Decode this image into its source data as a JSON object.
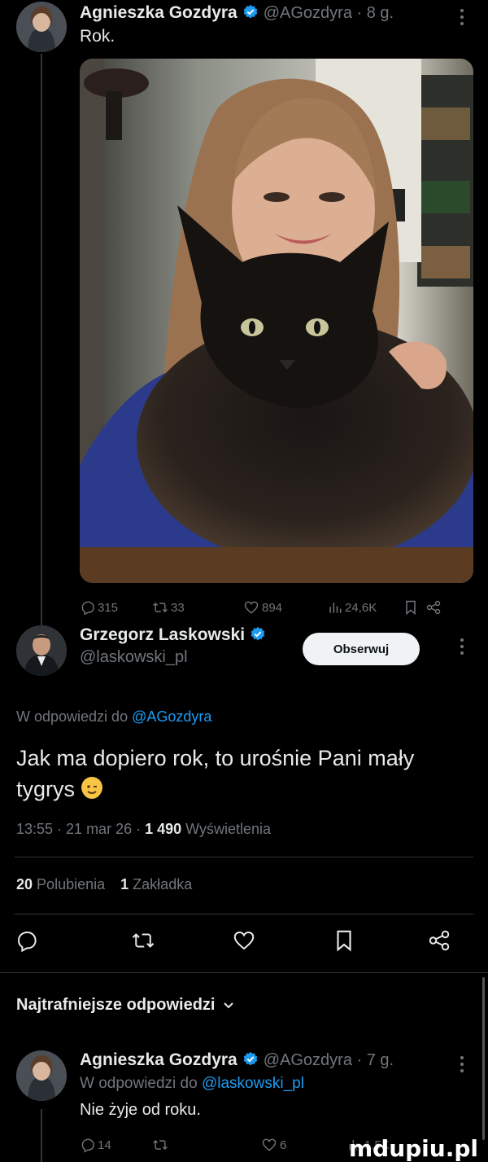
{
  "tweet1": {
    "name": "Agnieszka Gozdyra",
    "handle_time": "@AGozdyra · 8 g.",
    "text": "Rok.",
    "stats": {
      "replies": "315",
      "retweets": "33",
      "likes": "894",
      "views": "24,6K"
    }
  },
  "reply": {
    "name": "Grzegorz Laskowski",
    "handle": "@laskowski_pl",
    "follow_label": "Obserwuj",
    "reply_to_prefix": "W odpowiedzi do",
    "reply_to_handle": "@AGozdyra",
    "text_line1": "Jak ma dopiero rok, to urośnie Pani mały",
    "text_line2": "tygrys",
    "meta_time": "13:55 · 21 mar 26 ·",
    "meta_views_count": "1 490",
    "meta_views_label": "Wyświetlenia",
    "likes_count": "20",
    "likes_label": "Polubienia",
    "bookmarks_count": "1",
    "bookmarks_label": "Zakładka"
  },
  "section": {
    "title": "Najtrafniejsze odpowiedzi"
  },
  "tweet3": {
    "name": "Agnieszka Gozdyra",
    "handle_time": "@AGozdyra · 7 g.",
    "reply_to_prefix": "W odpowiedzi do",
    "reply_to_handle": "@laskowski_pl",
    "text": "Nie żyje od roku.",
    "stats": {
      "replies": "14",
      "likes": "6",
      "views": "1,5K"
    }
  },
  "watermark": "mdupiu.pl",
  "colors": {
    "background": "#000000",
    "text": "#e7e9ea",
    "muted": "#71767b",
    "link": "#1d9bf0",
    "verified": "#1d9bf0",
    "divider": "#2f3336"
  }
}
